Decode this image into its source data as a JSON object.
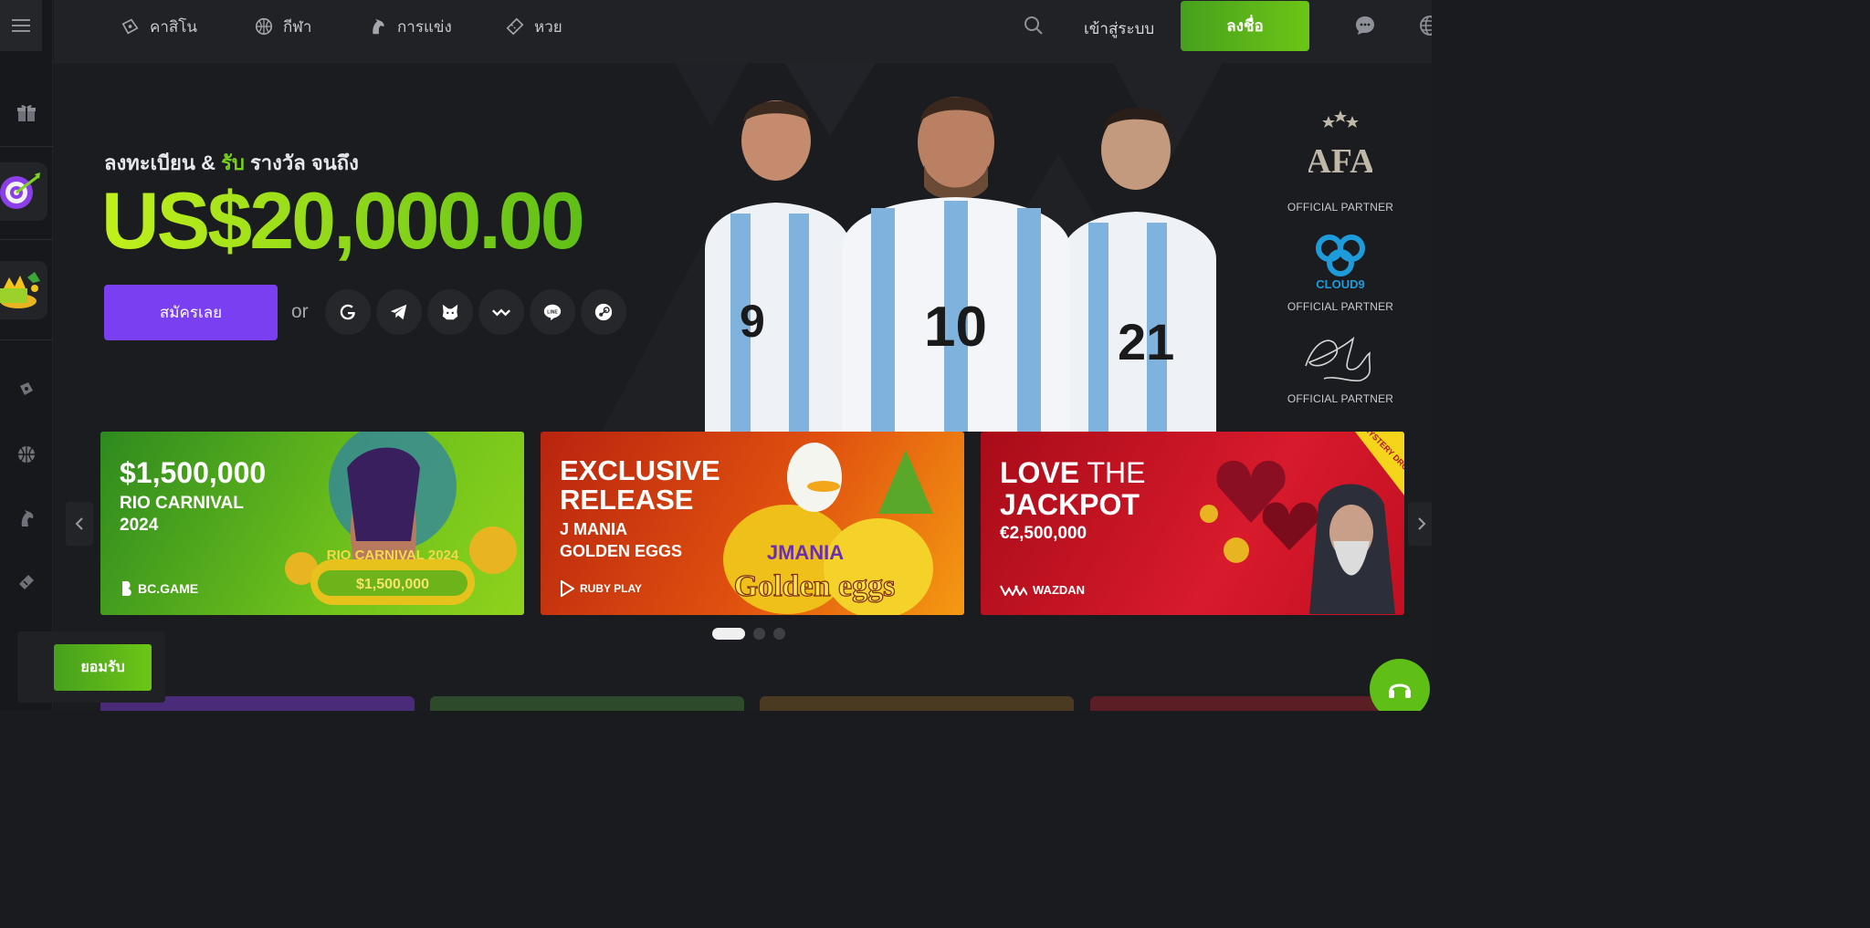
{
  "nav": {
    "items": [
      {
        "label": "คาสิโน",
        "icon": "casino-icon"
      },
      {
        "label": "กีฬา",
        "icon": "sports-icon"
      },
      {
        "label": "การแข่ง",
        "icon": "racing-icon"
      },
      {
        "label": "หวย",
        "icon": "lottery-icon"
      }
    ],
    "login_label": "เข้าสู่ระบบ",
    "signup_label": "ลงชื่อ"
  },
  "hero": {
    "subtitle_prefix": "ลงทะเบียน & ",
    "subtitle_highlight": "รับ",
    "subtitle_suffix": " รางวัล จนถึง",
    "amount": "US$20,000.00",
    "cta_label": "สมัครเลย",
    "or_label": "or",
    "social_icons": [
      "google-icon",
      "telegram-icon",
      "metamask-icon",
      "walletconnect-icon",
      "line-icon",
      "steam-icon"
    ],
    "line_text": "LINE",
    "jersey_numbers": [
      "9",
      "10",
      "21"
    ],
    "partners": [
      {
        "name": "AFA",
        "label": "OFFICIAL PARTNER"
      },
      {
        "name": "CLOUD9",
        "label": "OFFICIAL PARTNER"
      },
      {
        "name": "signature",
        "label": "OFFICIAL PARTNER"
      }
    ]
  },
  "banners": [
    {
      "line1": "$1,500,000",
      "line2": "RIO CARNIVAL",
      "line3": "2024",
      "brand": "BC.GAME",
      "art_title": "RIO CARNIVAL 2024",
      "art_amount": "$1,500,000",
      "color_a": "#2e8a1f",
      "color_b": "#8fd21c"
    },
    {
      "line1": "EXCLUSIVE",
      "line2": "RELEASE",
      "line3": "J MANIA",
      "line4": "GOLDEN EGGS",
      "brand": "RUBY PLAY",
      "art_title": "JMANIA",
      "art_sub": "Golden eggs",
      "color_a": "#c9310f",
      "color_b": "#f08a12"
    },
    {
      "line1a": "LOVE",
      "line1b": " THE",
      "line2": "JACKPOT",
      "line3": "€2,500,000",
      "brand": "WAZDAN",
      "ribbon": "MYSTERY DROP",
      "color_a": "#c4101c",
      "color_b": "#e8263a"
    }
  ],
  "cookie": {
    "accept_label": "ยอมรับ"
  },
  "colors": {
    "accent_green": "#6cc516",
    "cta_purple": "#7b3ff2",
    "bg": "#1b1c20"
  }
}
